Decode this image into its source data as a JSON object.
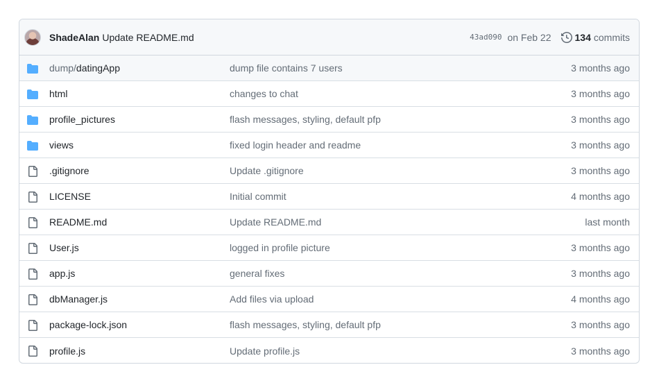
{
  "commit": {
    "author": "ShadeAlan",
    "message": "Update README.md",
    "sha": "43ad090",
    "date": "on Feb 22",
    "commit_count": "134",
    "commits_label": "commits"
  },
  "files": [
    {
      "type": "dir",
      "prefix": "dump/",
      "name": "datingApp",
      "message": "dump file contains 7 users",
      "time": "3 months ago"
    },
    {
      "type": "dir",
      "prefix": "",
      "name": "html",
      "message": "changes to chat",
      "time": "3 months ago"
    },
    {
      "type": "dir",
      "prefix": "",
      "name": "profile_pictures",
      "message": "flash messages, styling, default pfp",
      "time": "3 months ago"
    },
    {
      "type": "dir",
      "prefix": "",
      "name": "views",
      "message": "fixed login header and readme",
      "time": "3 months ago"
    },
    {
      "type": "file",
      "prefix": "",
      "name": ".gitignore",
      "message": "Update .gitignore",
      "time": "3 months ago"
    },
    {
      "type": "file",
      "prefix": "",
      "name": "LICENSE",
      "message": "Initial commit",
      "time": "4 months ago"
    },
    {
      "type": "file",
      "prefix": "",
      "name": "README.md",
      "message": "Update README.md",
      "time": "last month"
    },
    {
      "type": "file",
      "prefix": "",
      "name": "User.js",
      "message": "logged in profile picture",
      "time": "3 months ago"
    },
    {
      "type": "file",
      "prefix": "",
      "name": "app.js",
      "message": "general fixes",
      "time": "3 months ago"
    },
    {
      "type": "file",
      "prefix": "",
      "name": "dbManager.js",
      "message": "Add files via upload",
      "time": "4 months ago"
    },
    {
      "type": "file",
      "prefix": "",
      "name": "package-lock.json",
      "message": "flash messages, styling, default pfp",
      "time": "3 months ago"
    },
    {
      "type": "file",
      "prefix": "",
      "name": "profile.js",
      "message": "Update profile.js",
      "time": "3 months ago"
    }
  ],
  "colors": {
    "folder_icon": "#54aeff",
    "file_icon": "#636c76",
    "muted_text": "#636c76"
  }
}
